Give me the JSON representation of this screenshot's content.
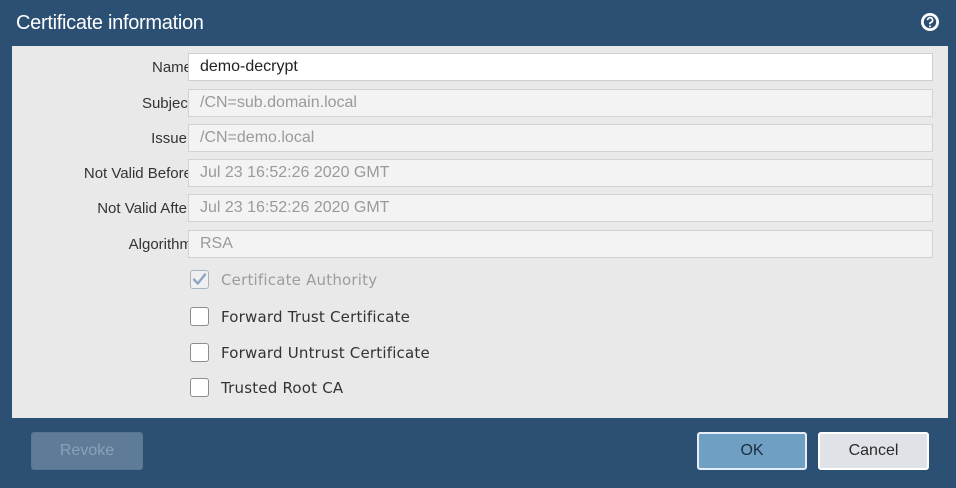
{
  "dialog": {
    "title": "Certificate information"
  },
  "fields": [
    {
      "label": "Name",
      "value": "demo-decrypt",
      "editable": true
    },
    {
      "label": "Subject",
      "value": "/CN=sub.domain.local",
      "editable": false
    },
    {
      "label": "Issuer",
      "value": "/CN=demo.local",
      "editable": false
    },
    {
      "label": "Not Valid Before",
      "value": "Jul 23 16:52:26 2020 GMT",
      "editable": false
    },
    {
      "label": "Not Valid After",
      "value": "Jul 23 16:52:26 2020 GMT",
      "editable": false
    },
    {
      "label": "Algorithm",
      "value": "RSA",
      "editable": false
    }
  ],
  "checkboxes": [
    {
      "label": "Certificate Authority",
      "checked": true,
      "disabled": true
    },
    {
      "label": "Forward Trust Certificate",
      "checked": false,
      "disabled": false
    },
    {
      "label": "Forward Untrust Certificate",
      "checked": false,
      "disabled": false
    },
    {
      "label": "Trusted Root CA",
      "checked": false,
      "disabled": false
    }
  ],
  "footer": {
    "revoke_label": "Revoke",
    "ok_label": "OK",
    "cancel_label": "Cancel"
  },
  "icons": {
    "help": "help-icon",
    "check": "checkmark-icon"
  },
  "colors": {
    "frame": "#2b5073",
    "content_bg": "#e9e9e9",
    "ok_button": "#6f9fc3",
    "cancel_button": "#dfe3e7",
    "checkmark_disabled": "#8fa6bd"
  }
}
